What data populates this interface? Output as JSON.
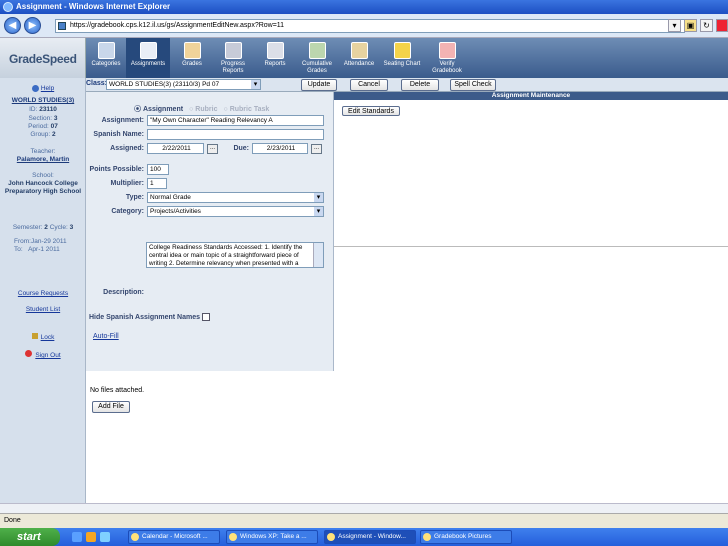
{
  "window": {
    "title": "Assignment - Windows Internet Explorer"
  },
  "browser": {
    "url": "https://gradebook.cps.k12.il.us/gs/AssignmentEditNew.aspx?Row=11"
  },
  "app": {
    "logo_text": "GradeSpeed"
  },
  "menu": [
    {
      "label": "Categories",
      "icon": "categories-icon"
    },
    {
      "label": "Assignments",
      "icon": "assignments-icon"
    },
    {
      "label": "Grades",
      "icon": "grades-icon"
    },
    {
      "label": "Progress Reports",
      "icon": "progress-reports-icon"
    },
    {
      "label": "Reports",
      "icon": "reports-icon"
    },
    {
      "label": "Cumulative Grades",
      "icon": "cumulative-grades-icon"
    },
    {
      "label": "Attendance",
      "icon": "attendance-icon"
    },
    {
      "label": "Seating Chart",
      "icon": "seating-chart-icon"
    },
    {
      "label": "Verify Gradebook",
      "icon": "verify-gradebook-icon"
    }
  ],
  "sidebar": {
    "help": "Help",
    "course": "WORLD STUDIES(3)",
    "id_label": "ID:",
    "id_value": "23110",
    "section_label": "Section:",
    "section_value": "3",
    "period_label": "Period:",
    "period_value": "07",
    "group_label": "Group:",
    "group_value": "2",
    "teacher_label": "Teacher:",
    "teacher_value": "Palamore, Martin",
    "school_label": "School:",
    "school_value": "John Hancock College Preparatory High School",
    "semester_text": "Semester:",
    "semester_value": "2",
    "cycle_text": "Cycle:",
    "cycle_value": "3",
    "from_label": "From:",
    "from_value": "Jan-29 2011",
    "to_label": "To:",
    "to_value": "Apr-1 2011",
    "course_requests": "Course Requests",
    "student_list": "Student List",
    "lock": "Lock",
    "sign_out": "Sign Out"
  },
  "toolbar": {
    "class_label": "Class:",
    "class_value": "WORLD STUDIES(3) (23110/3) Pd 07",
    "update": "Update",
    "cancel": "Cancel",
    "delete": "Delete",
    "spell_check": "Spell Check"
  },
  "maintenance_title": "Assignment Maintenance",
  "form": {
    "type_radios": [
      {
        "label": "Assignment",
        "checked": true
      },
      {
        "label": "Rubric",
        "checked": false
      },
      {
        "label": "Rubric Task",
        "checked": false
      }
    ],
    "assignment_label": "Assignment:",
    "assignment_value": "\"My Own Character\" Reading Relevancy A",
    "spanish_label": "Spanish Name:",
    "spanish_value": "",
    "assigned_label": "Assigned:",
    "assigned_value": "2/22/2011",
    "due_label": "Due:",
    "due_value": "2/23/2011",
    "calendar_btn": "...",
    "points_label": "Points Possible:",
    "points_value": "100",
    "multiplier_label": "Multiplier:",
    "multiplier_value": "1",
    "type_label": "Type:",
    "type_value": "Normal Grade",
    "category_label": "Category:",
    "category_value": "Projects/Activities",
    "description_label": "Description:",
    "description_value": "College Readiness Standards Accessed:  1. Identify the central idea or main topic of a straightforward piece of writing 2. Determine relevancy when presented with a",
    "hide_spanish_label": "Hide Spanish Assignment Names",
    "auto_fill": "Auto-Fill"
  },
  "edit_standards": "Edit Standards",
  "files": {
    "no_files": "No files attached.",
    "add_file": "Add File"
  },
  "status": "Done",
  "taskbar": {
    "start": "start",
    "tasks": [
      "Calendar - Microsoft ...",
      "Windows XP: Take a ...",
      "Assignment - Window...",
      "Gradebook Pictures"
    ]
  },
  "colors": {
    "titlebar": "#1d4fc2",
    "menubar": "#3a5b8c",
    "sidebar": "#d6e0ec",
    "start": "#2f8a2b"
  }
}
